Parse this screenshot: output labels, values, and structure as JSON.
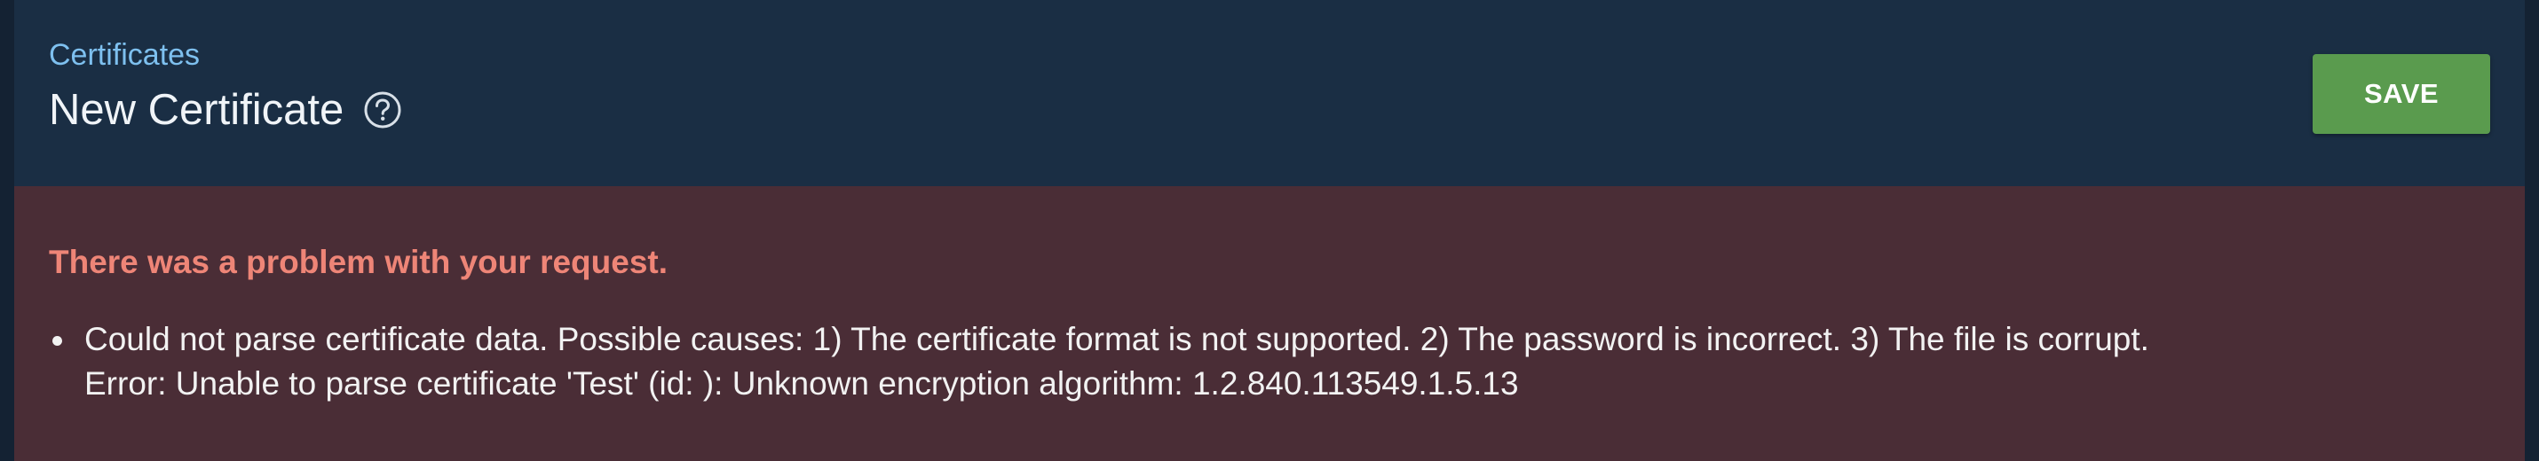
{
  "header": {
    "breadcrumb": "Certificates",
    "title": "New Certificate",
    "help_icon": "help-circle-icon",
    "save_label": "SAVE"
  },
  "error": {
    "title": "There was a problem with your request.",
    "items": [
      {
        "line1": "Could not parse certificate data. Possible causes: 1) The certificate format is not supported. 2) The password is incorrect. 3) The file is corrupt.",
        "line2": "Error: Unable to parse certificate 'Test' (id: ): Unknown encryption algorithm: 1.2.840.113549.1.5.13"
      }
    ]
  },
  "colors": {
    "background": "#142233",
    "panel": "#1a2e44",
    "accent_link": "#7ec0ef",
    "save_button": "#5a9b4e",
    "error_background": "#4a2d36",
    "error_title": "#ee8577"
  }
}
